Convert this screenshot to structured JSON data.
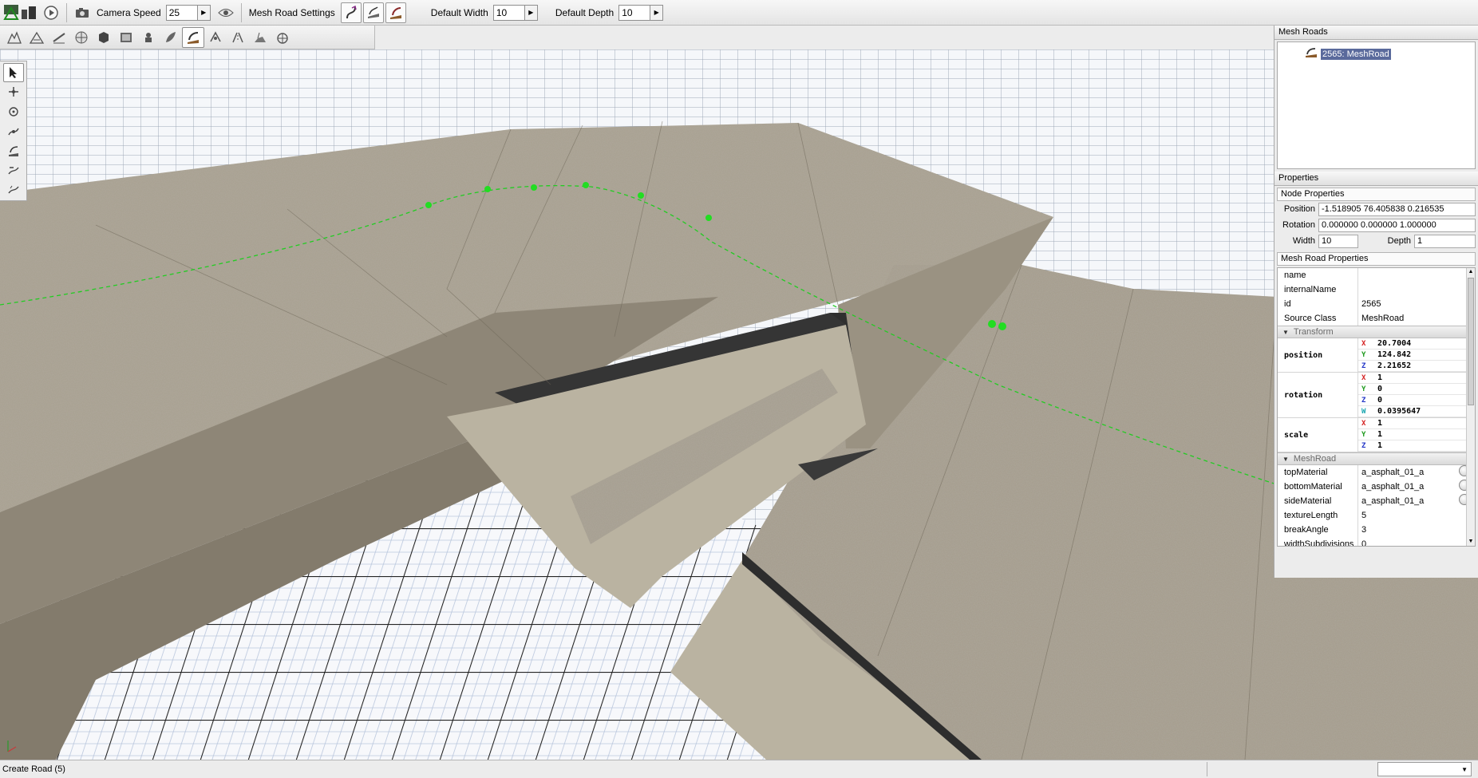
{
  "toolbar": {
    "camera_speed_label": "Camera Speed",
    "camera_speed_value": "25",
    "mesh_road_settings_label": "Mesh Road Settings",
    "default_width_label": "Default Width",
    "default_width_value": "10",
    "default_depth_label": "Default Depth",
    "default_depth_value": "10"
  },
  "tool_icons": [
    "terrain-sculpt-icon",
    "terrain-paint-icon",
    "decal-icon",
    "sphere-icon",
    "cube-icon",
    "image-icon",
    "river-icon",
    "forest-icon",
    "mesh-road-icon",
    "particle-icon",
    "road-icon",
    "navmesh-icon",
    "shape-icon"
  ],
  "palette_icons": [
    "select-arrow-icon",
    "add-node-icon",
    "rotate-node-icon",
    "move-node-icon",
    "insert-node-icon",
    "remove-node-icon",
    "split-node-icon"
  ],
  "mesh_roads": {
    "header": "Mesh Roads",
    "items": [
      {
        "label": "2565: MeshRoad"
      }
    ]
  },
  "properties": {
    "header": "Properties",
    "node_properties": {
      "title": "Node Properties",
      "position_label": "Position",
      "position_value": "-1.518905 76.405838 0.216535",
      "rotation_label": "Rotation",
      "rotation_value": "0.000000 0.000000 1.000000",
      "width_label": "Width",
      "width_value": "10",
      "depth_label": "Depth",
      "depth_value": "1"
    },
    "mesh_road_properties": {
      "title": "Mesh Road Properties",
      "fields": [
        {
          "key": "name",
          "value": ""
        },
        {
          "key": "internalName",
          "value": ""
        },
        {
          "key": "id",
          "value": "2565"
        },
        {
          "key": "Source Class",
          "value": "MeshRoad"
        }
      ],
      "transform_group": "Transform",
      "position": {
        "label": "position",
        "x": "20.7004",
        "y": "124.842",
        "z": "2.21652"
      },
      "rotation": {
        "label": "rotation",
        "x": "1",
        "y": "0",
        "z": "0",
        "w": "0.0395647"
      },
      "scale": {
        "label": "scale",
        "x": "1",
        "y": "1",
        "z": "1"
      },
      "meshroad_group": "MeshRoad",
      "meshroad_fields": [
        {
          "key": "topMaterial",
          "value": "a_asphalt_01_a"
        },
        {
          "key": "bottomMaterial",
          "value": "a_asphalt_01_a"
        },
        {
          "key": "sideMaterial",
          "value": "a_asphalt_01_a"
        },
        {
          "key": "textureLength",
          "value": "5"
        },
        {
          "key": "breakAngle",
          "value": "3"
        },
        {
          "key": "widthSubdivisions",
          "value": "0"
        }
      ],
      "axis_x": "X",
      "axis_y": "Y",
      "axis_z": "Z",
      "axis_w": "W"
    }
  },
  "status": {
    "text": "Create Road (5)"
  },
  "colors": {
    "selection": "#5a6a9c",
    "spline": "#22cc22"
  }
}
